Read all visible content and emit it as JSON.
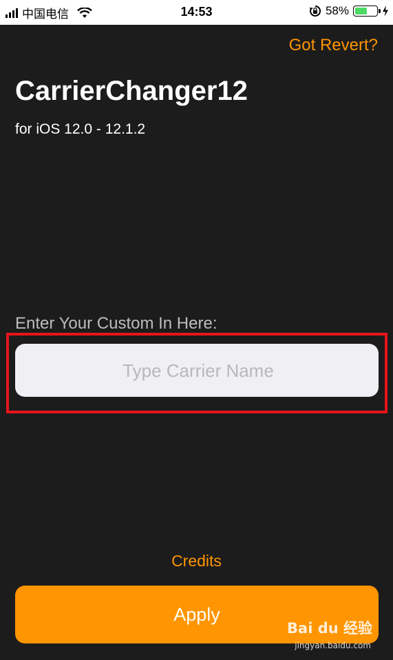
{
  "status_bar": {
    "carrier": "中国电信",
    "time": "14:53",
    "battery_percent": "58%",
    "battery_level": 0.58,
    "icons": [
      "signal-icon",
      "wifi-icon",
      "orientation-lock-icon",
      "battery-icon",
      "charging-bolt-icon"
    ]
  },
  "header": {
    "revert_link": "Got Revert?",
    "title": "CarrierChanger12",
    "subtitle": "for iOS 12.0 - 12.1.2"
  },
  "form": {
    "label": "Enter Your Custom In Here:",
    "input_value": "",
    "input_placeholder": "Type Carrier Name"
  },
  "footer": {
    "credits_label": "Credits",
    "apply_label": "Apply"
  },
  "watermark": {
    "brand": "Bai du 经验",
    "url": "jingyan.baidu.com"
  },
  "colors": {
    "background": "#1c1c1c",
    "accent": "#ff9500",
    "input_background": "#efeff4",
    "highlight": "#e8141b"
  }
}
